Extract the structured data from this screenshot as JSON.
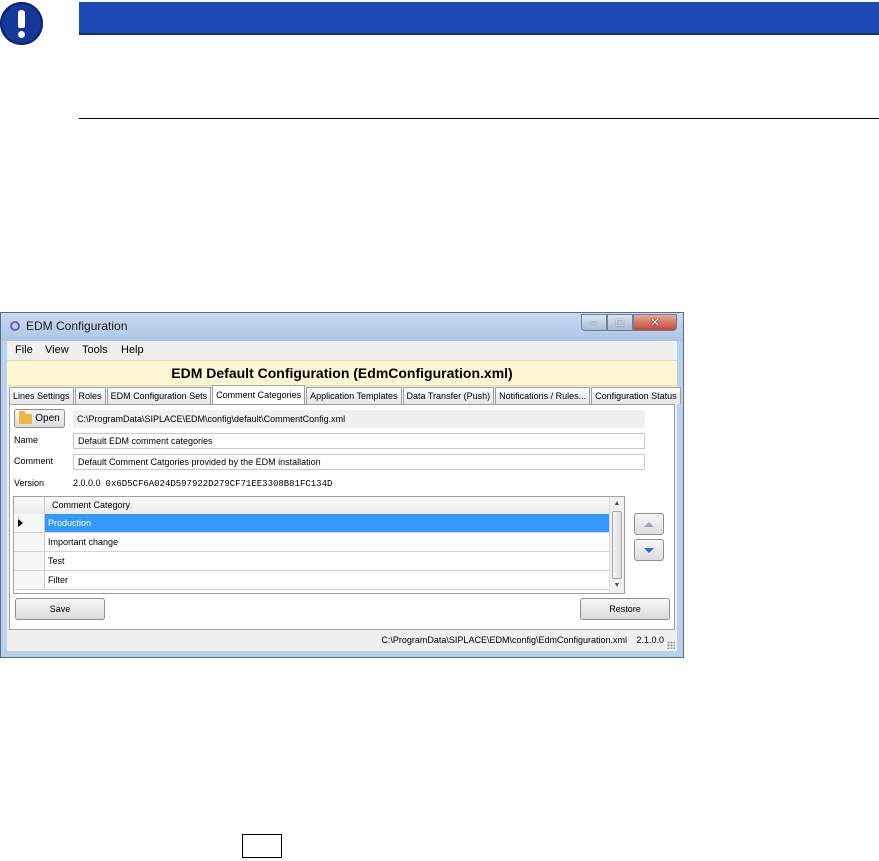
{
  "window": {
    "title": "EDM Configuration",
    "caption_buttons": {
      "minimize": "–",
      "maximize": "□",
      "close": "✕"
    }
  },
  "menu": [
    "File",
    "View",
    "Tools",
    "Help"
  ],
  "banner": "EDM Default Configuration (EdmConfiguration.xml)",
  "tabs": [
    "Lines Settings",
    "Roles",
    "EDM Configuration Sets",
    "Comment Categories",
    "Application Templates",
    "Data Transfer (Push)",
    "Notifications / Rules...",
    "Configuration Status"
  ],
  "active_tab": "Comment Categories",
  "form": {
    "open_label": "Open",
    "path": "C:\\ProgramData\\SIPLACE\\EDM\\config\\default\\CommentConfig.xml",
    "name_label": "Name",
    "name_value": "Default EDM comment categories",
    "comment_label": "Comment",
    "comment_value": "Default Comment Catgories provided by the EDM installation",
    "version_label": "Version",
    "version_value": "2.0.0.0",
    "version_hash": "0x6D5CF6A024D597922D279CF71EE3308B81FC134D"
  },
  "grid": {
    "header": "Comment Category",
    "rows": [
      "Production",
      "Important change",
      "Test",
      "Filter"
    ],
    "selected_index": 0
  },
  "buttons": {
    "save": "Save",
    "restore": "Restore"
  },
  "status": {
    "path": "C:\\ProgramData\\SIPLACE\\EDM\\config\\EdmConfiguration.xml",
    "version": "2.1.0.0"
  },
  "colors": {
    "notice_bar": "#1d49b4",
    "banner_bg": "#fef7d3",
    "selection": "#3399ff"
  }
}
